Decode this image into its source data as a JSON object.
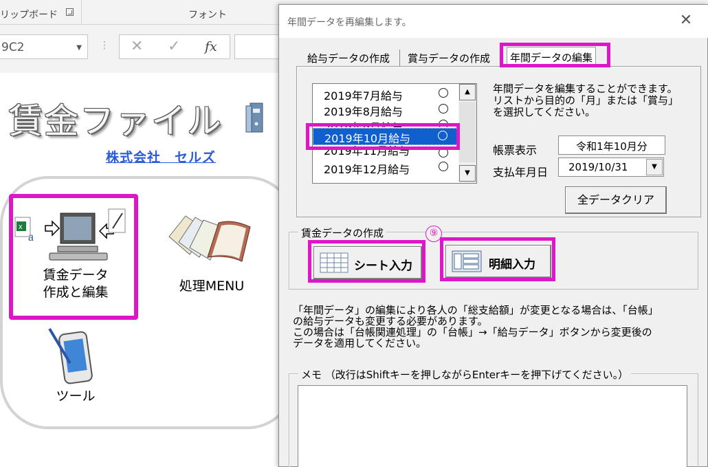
{
  "ribbon": {
    "clipboard_label": "リップボード",
    "font_label": "フォント"
  },
  "formula_bar": {
    "name_box": "9C2",
    "cancel_symbol": "✕",
    "enter_symbol": "✓",
    "fx_label": "fx"
  },
  "sheet": {
    "title": "賃金ファイル",
    "company_link": "株式会社　セルズ",
    "menu_items": [
      {
        "label_line1": "賃金データ",
        "label_line2": "作成と編集"
      },
      {
        "label_line1": "処理MENU",
        "label_line2": ""
      },
      {
        "label_line1": "ツール",
        "label_line2": ""
      }
    ]
  },
  "dialog": {
    "title": "年間データを再編集します。",
    "close_symbol": "✕",
    "tabs": [
      {
        "label": "給与データの作成"
      },
      {
        "label": "賞与データの作成"
      },
      {
        "label": "年間データの編集"
      }
    ],
    "list_items": [
      {
        "label": "2019年7月給与"
      },
      {
        "label": "2019年8月給与"
      },
      {
        "label": "2019年9月給与"
      },
      {
        "label": "2019年10月給与"
      },
      {
        "label": "2019年11月給与"
      },
      {
        "label": "2019年12月給与"
      }
    ],
    "selected_item": "2019年10月給与",
    "description_line1": "年間データを編集することができます。",
    "description_line2": "リストから目的の「月」または「賞与」",
    "description_line3": "を選択してください。",
    "report_label": "帳票表示",
    "report_value": "令和1年10月分",
    "paydate_label": "支払年月日",
    "paydate_value": "2019/10/31",
    "clear_button": "全データクリア",
    "wage_frame_title": "賃金データの作成",
    "step_marker": "⑨",
    "sheet_input_button": "シート入力",
    "detail_input_button": "明細入力",
    "notice_line1": "「年間データ」の編集により各人の「総支給額」が変更となる場合は、「台帳」",
    "notice_line2": "の給与データも変更する必要があります。",
    "notice_line3": "この場合は「台帳関連処理」の「台帳」→「給与データ」ボタンから変更後の",
    "notice_line4": "データを適用してください。",
    "memo_title": "メモ （改行はShiftキーを押しながらEnterキーを押下げてください。）",
    "memo_value": ""
  },
  "colors": {
    "highlight": "#dd16c8",
    "selection": "#0f5fcf",
    "link": "#2a5bd7"
  }
}
